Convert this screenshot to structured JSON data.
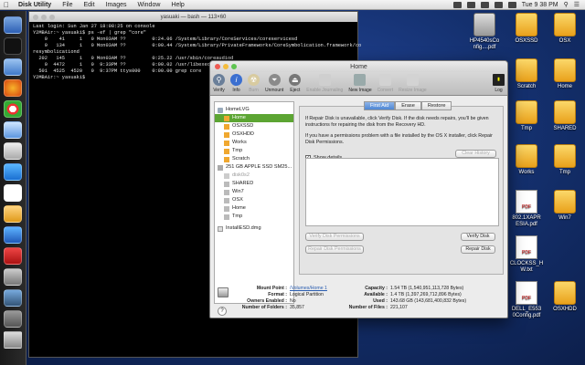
{
  "menubar": {
    "app_name": "Disk Utility",
    "items": [
      "File",
      "Edit",
      "Images",
      "Window",
      "Help"
    ],
    "clock": "Tue 9 38 PM"
  },
  "terminal": {
    "title": "yasuaki — bash — 113×60",
    "lines": [
      "Last login: Sun Jan 27 18:08:25 on console",
      "Y2MBAir:~ yasuaki$ ps -ef | grep \"core\"",
      "    0    41     1   0 Mon03AM ??         0:24.06 /System/Library/CoreServices/coreservicesd",
      "    0   134     1   0 Mon03AM ??         0:00.44 /System/Library/PrivateFrameworks/CoreSymbolication.framework/co",
      "resymbolicationd",
      "  202   145     1   0 Mon03AM ??         0:25.22 /usr/sbin/coreaudiod",
      "    0  4472     1   0  9:33PM ??         0:00.02 /usr/libexec/corestoraged",
      "  501  4525  4520   0  9:37PM ttys000    0:00.00 grep core",
      "Y2MBAir:~ yasuaki$ "
    ]
  },
  "desktop_icons": [
    {
      "label": "HP4540sCo nfig....pdf",
      "kind": "doc"
    },
    {
      "label": "OSXSSD",
      "kind": "drive"
    },
    {
      "label": "OSX",
      "kind": "drive"
    },
    {
      "label": "Home",
      "kind": "drive"
    },
    {
      "label": "Scratch",
      "kind": "drive"
    },
    {
      "label": "Tmp",
      "kind": "drive"
    },
    {
      "label": "SHARED",
      "kind": "drive"
    },
    {
      "label": "Works",
      "kind": "drive"
    },
    {
      "label": "Tmp",
      "kind": "drive"
    },
    {
      "label": "802.1XAPR ESIA.pdf",
      "kind": "doc"
    },
    {
      "label": "Win7",
      "kind": "drive"
    },
    {
      "label": "CLOCKSS_H W.txt",
      "kind": "doc"
    },
    {
      "label": "DELL_E553 0Config.pdf",
      "kind": "doc"
    },
    {
      "label": "OSXHDD",
      "kind": "drive"
    }
  ],
  "window": {
    "title": "Home",
    "toolbar": [
      {
        "label": "Verify",
        "icon": "microscope-icon",
        "enabled": true
      },
      {
        "label": "Info",
        "icon": "info-icon",
        "enabled": true
      },
      {
        "label": "Burn",
        "icon": "burn-icon",
        "enabled": false
      },
      {
        "label": "Unmount",
        "icon": "unmount-icon",
        "enabled": true
      },
      {
        "label": "Eject",
        "icon": "eject-icon",
        "enabled": true
      },
      {
        "label": "Enable Journaling",
        "icon": "journal-icon",
        "enabled": false
      },
      {
        "label": "New Image",
        "icon": "new-image-icon",
        "enabled": true
      },
      {
        "label": "Convert",
        "icon": "convert-icon",
        "enabled": false
      },
      {
        "label": "Resize Image",
        "icon": "resize-icon",
        "enabled": false
      }
    ],
    "log_label": "Log",
    "sidebar": [
      {
        "label": "HomeLVG",
        "level": 0,
        "kind": "group",
        "selected": false,
        "dim": false
      },
      {
        "label": "Home",
        "level": 1,
        "kind": "volume",
        "selected": true,
        "dim": false
      },
      {
        "label": "OSXSSD",
        "level": 1,
        "kind": "volume",
        "selected": false,
        "dim": false
      },
      {
        "label": "OSXHDD",
        "level": 1,
        "kind": "volume",
        "selected": false,
        "dim": false
      },
      {
        "label": "Works",
        "level": 1,
        "kind": "volume",
        "selected": false,
        "dim": false
      },
      {
        "label": "Tmp",
        "level": 1,
        "kind": "volume",
        "selected": false,
        "dim": false
      },
      {
        "label": "Scratch",
        "level": 1,
        "kind": "volume",
        "selected": false,
        "dim": false
      },
      {
        "label": "251 GB APPLE SSD SM25...",
        "level": 0,
        "kind": "disk",
        "selected": false,
        "dim": false
      },
      {
        "label": "disk0s2",
        "level": 1,
        "kind": "volume-gray",
        "selected": false,
        "dim": true
      },
      {
        "label": "SHARED",
        "level": 1,
        "kind": "volume-gray",
        "selected": false,
        "dim": false
      },
      {
        "label": "Win7",
        "level": 1,
        "kind": "volume-gray",
        "selected": false,
        "dim": false
      },
      {
        "label": "OSX",
        "level": 1,
        "kind": "volume-gray",
        "selected": false,
        "dim": false
      },
      {
        "label": "Home",
        "level": 1,
        "kind": "volume-gray",
        "selected": false,
        "dim": false
      },
      {
        "label": "Tmp",
        "level": 1,
        "kind": "volume-gray",
        "selected": false,
        "dim": false
      },
      {
        "label": "InstallESD.dmg",
        "level": 0,
        "kind": "image",
        "selected": false,
        "dim": false
      }
    ],
    "tabs": [
      "First Aid",
      "Erase",
      "Restore"
    ],
    "first_aid": {
      "para1": "If Repair Disk is unavailable, click Verify Disk. If the disk needs repairs, you'll be given instructions for repairing the disk from the Recovery HD.",
      "para2": "If you have a permissions problem with a file installed by the OS X installer, click Repair Disk Permissions.",
      "show_details": "Show details",
      "clear_history": "Clear History",
      "verify_permissions": "Verify Disk Permissions",
      "repair_permissions": "Repair Disk Permissions",
      "verify_disk": "Verify Disk",
      "repair_disk": "Repair Disk"
    },
    "info": {
      "mount_point_k": "Mount Point :",
      "mount_point_v": "/Volumes/Home 1",
      "format_k": "Format :",
      "format_v": "Logical Partition",
      "owners_k": "Owners Enabled :",
      "owners_v": "No",
      "folders_k": "Number of Folders :",
      "folders_v": "35,857",
      "capacity_k": "Capacity :",
      "capacity_v": "1.54 TB (1,540,951,113,728 Bytes)",
      "available_k": "Available :",
      "available_v": "1.4 TB (1,397,269,712,896 Bytes)",
      "used_k": "Used :",
      "used_v": "143.68 GB (143,681,400,832 Bytes)",
      "files_k": "Number of Files :",
      "files_v": "221,107",
      "help": "?"
    }
  }
}
